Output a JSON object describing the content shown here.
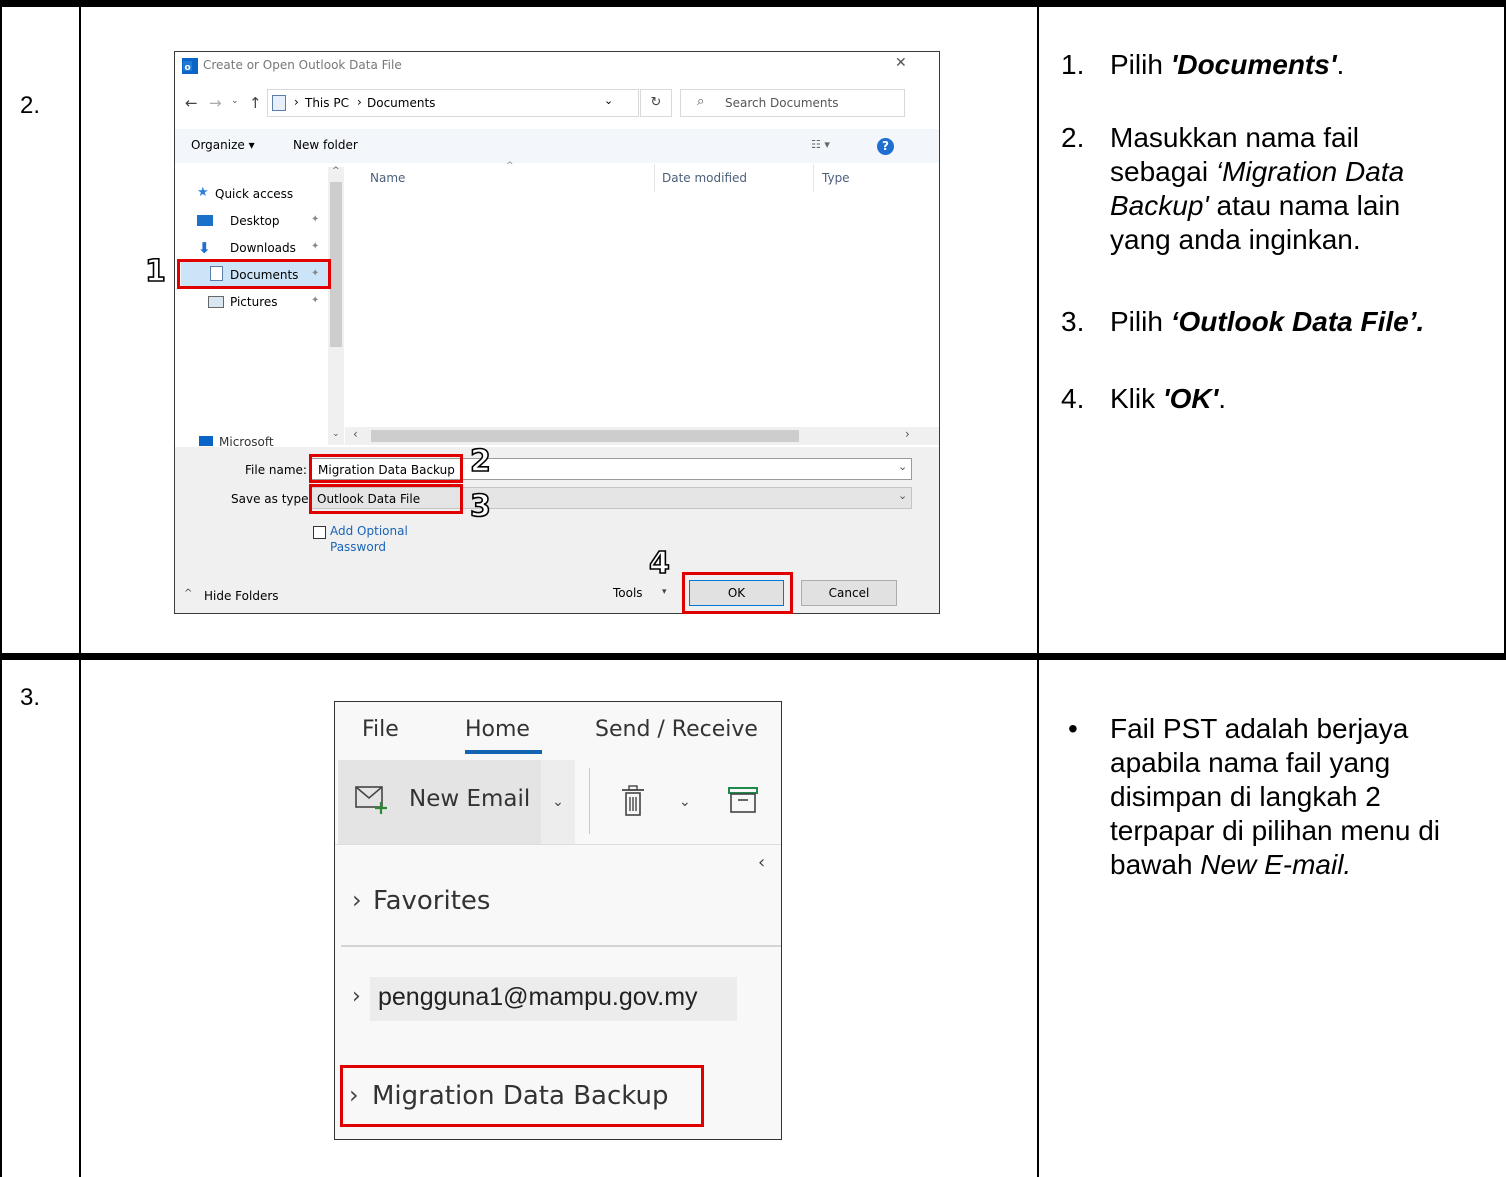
{
  "rows": [
    {
      "number": "2.",
      "dialog": {
        "title": "Create or Open Outlook Data File",
        "close": "✕",
        "breadcrumb": [
          "This PC",
          "Documents"
        ],
        "search_placeholder": "Search Documents",
        "organize": "Organize ▾",
        "new_folder": "New folder",
        "columns": [
          "Name",
          "Date modified",
          "Type"
        ],
        "nav_items": [
          "Quick access",
          "Desktop",
          "Downloads",
          "Documents",
          "Pictures",
          "Microsoft Outlook"
        ],
        "file_name_label": "File name:",
        "file_name_value": "Migration Data Backup",
        "save_type_label": "Save as type:",
        "save_type_value": "Outlook Data File",
        "add_password": [
          "Add Optional",
          "Password"
        ],
        "hide_folders": "Hide Folders",
        "tools": "Tools",
        "ok": "OK",
        "cancel": "Cancel",
        "callouts": [
          "1",
          "2",
          "3",
          "4"
        ]
      },
      "instructions": [
        {
          "num": "1.",
          "lines": [
            [
              {
                "t": "Pilih ",
                "s": "n"
              },
              {
                "t": "'Documents'",
                "s": "bi"
              },
              {
                "t": ".",
                "s": "n"
              }
            ]
          ]
        },
        {
          "num": "2.",
          "lines": [
            [
              {
                "t": "Masukkan nama fail",
                "s": "n"
              }
            ],
            [
              {
                "t": "sebagai ",
                "s": "n"
              },
              {
                "t": "‘Migration Data",
                "s": "i"
              }
            ],
            [
              {
                "t": "Backup'",
                "s": "i"
              },
              {
                "t": " atau nama lain",
                "s": "n"
              }
            ],
            [
              {
                "t": "yang anda inginkan.",
                "s": "n"
              }
            ]
          ]
        },
        {
          "num": "3.",
          "lines": [
            [
              {
                "t": "Pilih ",
                "s": "n"
              },
              {
                "t": "‘Outlook Data File’.",
                "s": "bi"
              }
            ]
          ]
        },
        {
          "num": "4.",
          "lines": [
            [
              {
                "t": "Klik ",
                "s": "n"
              },
              {
                "t": "'OK'",
                "s": "bi"
              },
              {
                "t": ".",
                "s": "n"
              }
            ]
          ]
        }
      ]
    },
    {
      "number": "3.",
      "outlook": {
        "tabs": [
          "File",
          "Home",
          "Send / Receive"
        ],
        "new_email": "New Email",
        "folders": [
          "Favorites",
          "pengguna1@mampu.gov.my",
          "Migration Data Backup"
        ]
      },
      "instructions": [
        {
          "bullet": "•",
          "lines": [
            [
              {
                "t": "Fail PST adalah berjaya",
                "s": "n"
              }
            ],
            [
              {
                "t": "apabila nama fail yang",
                "s": "n"
              }
            ],
            [
              {
                "t": "disimpan di langkah 2",
                "s": "n"
              }
            ],
            [
              {
                "t": "terpapar di pilihan menu di",
                "s": "n"
              }
            ],
            [
              {
                "t": "bawah ",
                "s": "n"
              },
              {
                "t": "New E-mail.",
                "s": "i"
              }
            ]
          ]
        }
      ]
    }
  ]
}
